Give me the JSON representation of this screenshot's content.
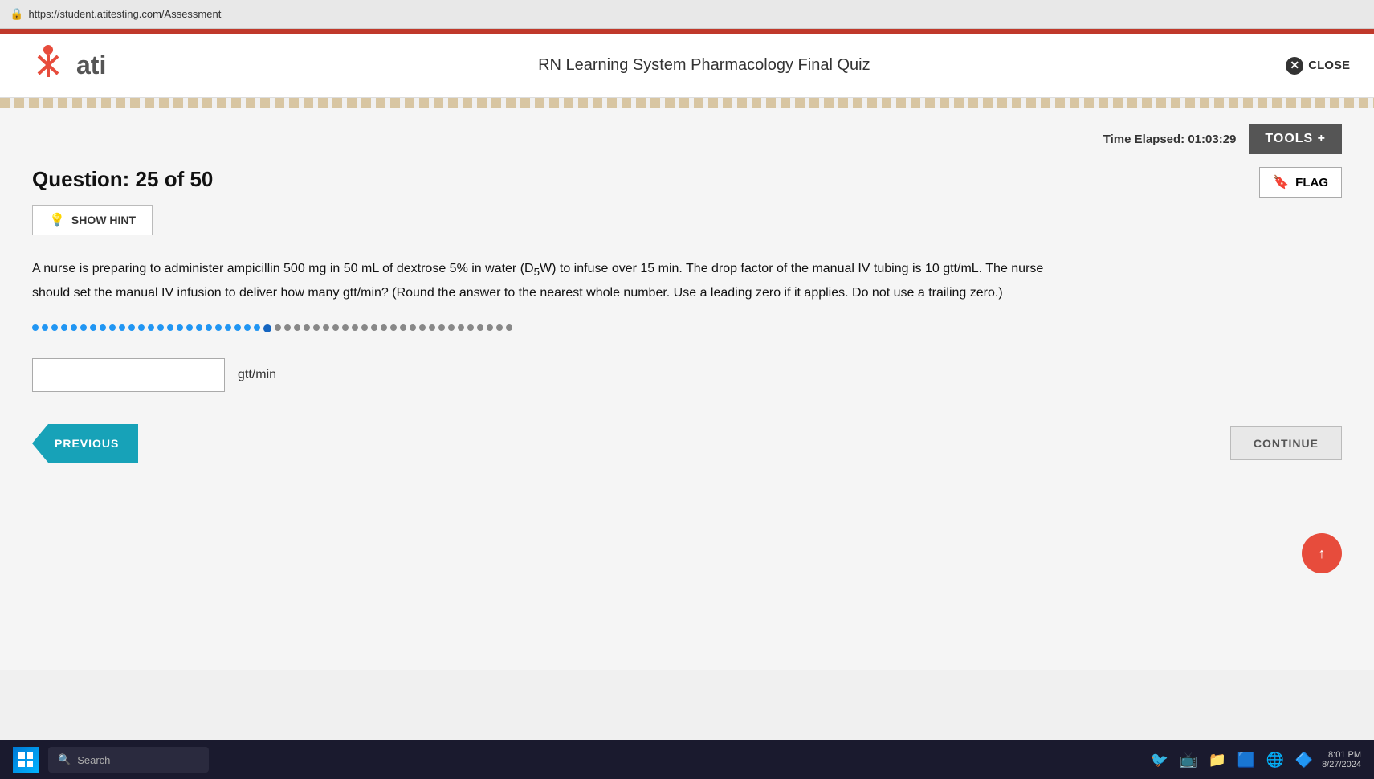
{
  "browser": {
    "url": "https://student.atitesting.com/Assessment",
    "lock_icon": "🔒"
  },
  "header": {
    "quiz_title": "RN Learning System Pharmacology Final Quiz",
    "close_label": "CLOSE",
    "logo_text": "ati"
  },
  "toolbar": {
    "time_elapsed_label": "Time Elapsed:",
    "time_value": "01:03:29",
    "tools_label": "TOOLS +",
    "flag_label": "FLAG"
  },
  "question": {
    "header": "Question: 25 of 50",
    "show_hint_label": "SHOW HINT",
    "text": "A nurse is preparing to administer ampicillin 500 mg in 50 mL of dextrose 5% in water (D₅W) to infuse over 15 min. The drop factor of the manual IV tubing is 10 gtt/mL. The nurse should set the manual IV infusion to deliver how many gtt/min? (Round the answer to the nearest whole number. Use a leading zero if it applies. Do not use a trailing zero.)",
    "answer_placeholder": "",
    "unit_label": "gtt/min",
    "total_dots": 50,
    "current_dot": 25
  },
  "navigation": {
    "previous_label": "PREVIOUS",
    "continue_label": "CONTINUE"
  },
  "taskbar": {
    "search_placeholder": "Search",
    "time": "8:01 PM",
    "date": "8/27/2024"
  }
}
